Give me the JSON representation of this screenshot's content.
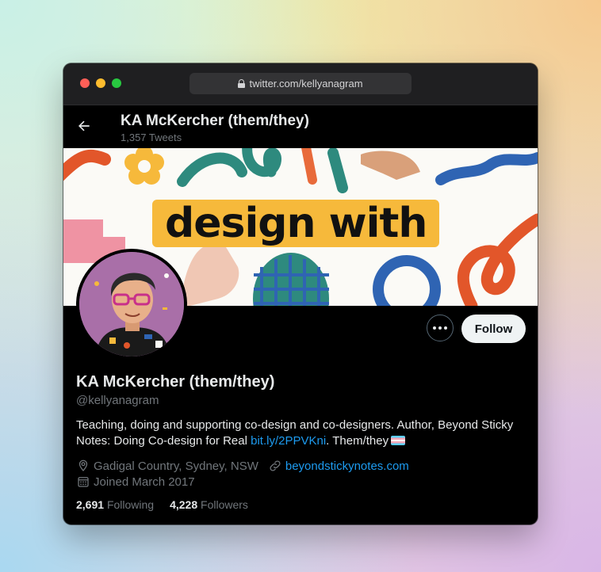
{
  "browser": {
    "url": "twitter.com/kellyanagram"
  },
  "header": {
    "name": "KA McKercher (them/they)",
    "tweet_count": "1,357 Tweets"
  },
  "banner": {
    "text": "design with"
  },
  "actions": {
    "follow_label": "Follow",
    "more_icon": "more-horizontal-icon"
  },
  "profile": {
    "name": "KA McKercher (them/they)",
    "handle": "@kellyanagram",
    "bio_text": "Teaching, doing and supporting co-design and co-designers. Author, Beyond Sticky Notes: Doing Co-design for Real ",
    "bio_link": "bit.ly/2PPVKni",
    "bio_suffix": ". Them/they",
    "location": "Gadigal Country, Sydney, NSW",
    "website": "beyondstickynotes.com",
    "joined": "Joined March 2017",
    "following_count": "2,691",
    "following_label": "Following",
    "followers_count": "4,228",
    "followers_label": "Followers"
  },
  "colors": {
    "accent": "#1d9bf0",
    "banner_yellow": "#f6b93b"
  }
}
